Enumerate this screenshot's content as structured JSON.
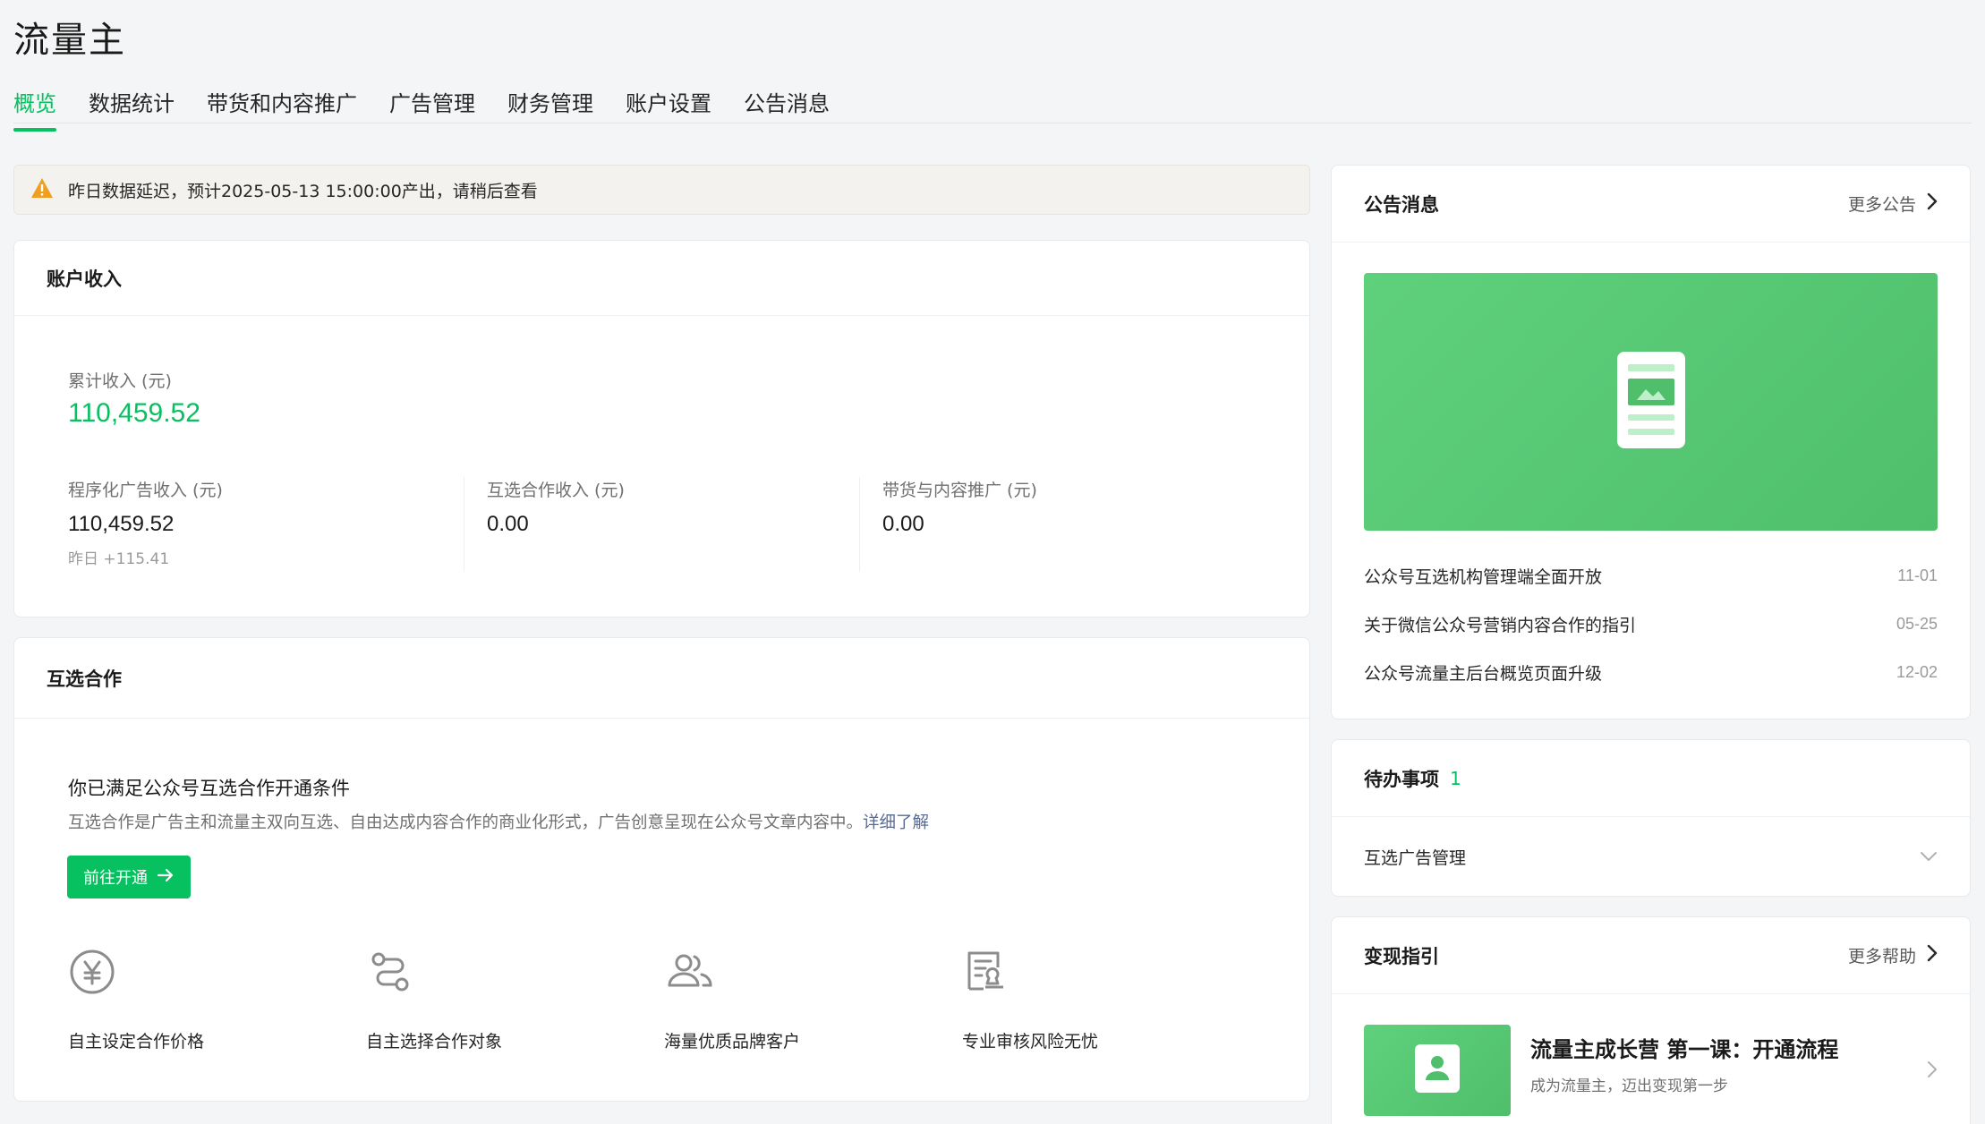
{
  "app": {
    "title": "流量主"
  },
  "tabs": [
    {
      "label": "概览",
      "active": true
    },
    {
      "label": "数据统计"
    },
    {
      "label": "带货和内容推广"
    },
    {
      "label": "广告管理"
    },
    {
      "label": "财务管理"
    },
    {
      "label": "账户设置"
    },
    {
      "label": "公告消息"
    }
  ],
  "alert": {
    "icon": "warning-icon",
    "text": "昨日数据延迟，预计2025-05-13 15:00:00产出，请稍后查看"
  },
  "income": {
    "title": "账户收入",
    "total_label": "累计收入 (元)",
    "total_value": "110,459.52",
    "items": [
      {
        "label": "程序化广告收入 (元)",
        "value": "110,459.52",
        "sub": "昨日 +115.41"
      },
      {
        "label": "互选合作收入 (元)",
        "value": "0.00"
      },
      {
        "label": "带货与内容推广 (元)",
        "value": "0.00"
      }
    ]
  },
  "cooperation": {
    "title": "互选合作",
    "headline": "你已满足公众号互选合作开通条件",
    "desc": "互选合作是广告主和流量主双向互选、自由达成内容合作的商业化形式，广告创意呈现在公众号文章内容中。",
    "link": "详细了解",
    "button": "前往开通",
    "features": [
      {
        "icon": "yuan-icon",
        "label": "自主设定合作价格"
      },
      {
        "icon": "route-icon",
        "label": "自主选择合作对象"
      },
      {
        "icon": "users-icon",
        "label": "海量优质品牌客户"
      },
      {
        "icon": "review-icon",
        "label": "专业审核风险无忧"
      }
    ]
  },
  "announcements": {
    "title": "公告消息",
    "more": "更多公告",
    "items": [
      {
        "title": "公众号互选机构管理端全面开放",
        "date": "11-01"
      },
      {
        "title": "关于微信公众号营销内容合作的指引",
        "date": "05-25"
      },
      {
        "title": "公众号流量主后台概览页面升级",
        "date": "12-02"
      }
    ]
  },
  "todo": {
    "title": "待办事项",
    "count": "1",
    "items": [
      {
        "label": "互选广告管理"
      }
    ]
  },
  "guide": {
    "title": "变现指引",
    "more": "更多帮助",
    "item_title": "流量主成长营 第一课：开通流程",
    "item_desc": "成为流量主，迈出变现第一步"
  },
  "colors": {
    "accent": "#07c160",
    "banner": "#5ac978",
    "link": "#576b95",
    "warning": "#f0a020"
  }
}
